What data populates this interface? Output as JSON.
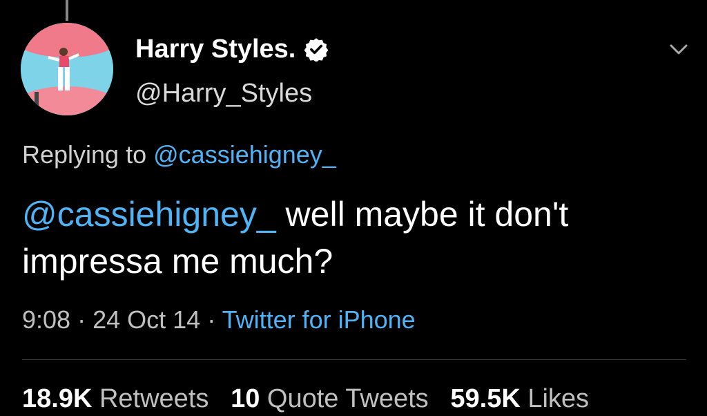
{
  "tweet": {
    "author": {
      "display_name": "Harry Styles.",
      "handle": "@Harry_Styles",
      "verified": true
    },
    "replying_prefix": "Replying to",
    "replying_to": "@cassiehigney_",
    "mention": "@cassiehigney_",
    "body": "well maybe it don't impressa me much?",
    "time": "9:08",
    "separator": "·",
    "date": "24 Oct 14",
    "source": "Twitter for iPhone",
    "stats": {
      "retweets_count": "18.9K",
      "retweets_label": "Retweets",
      "quotes_count": "10",
      "quotes_label": "Quote Tweets",
      "likes_count": "59.5K",
      "likes_label": "Likes"
    }
  },
  "icons": {
    "verified": "verified-badge-icon",
    "menu": "chevron-down-icon"
  },
  "colors": {
    "background": "#000000",
    "link": "#4fb3f6",
    "muted_text": "#c0c0c0"
  }
}
